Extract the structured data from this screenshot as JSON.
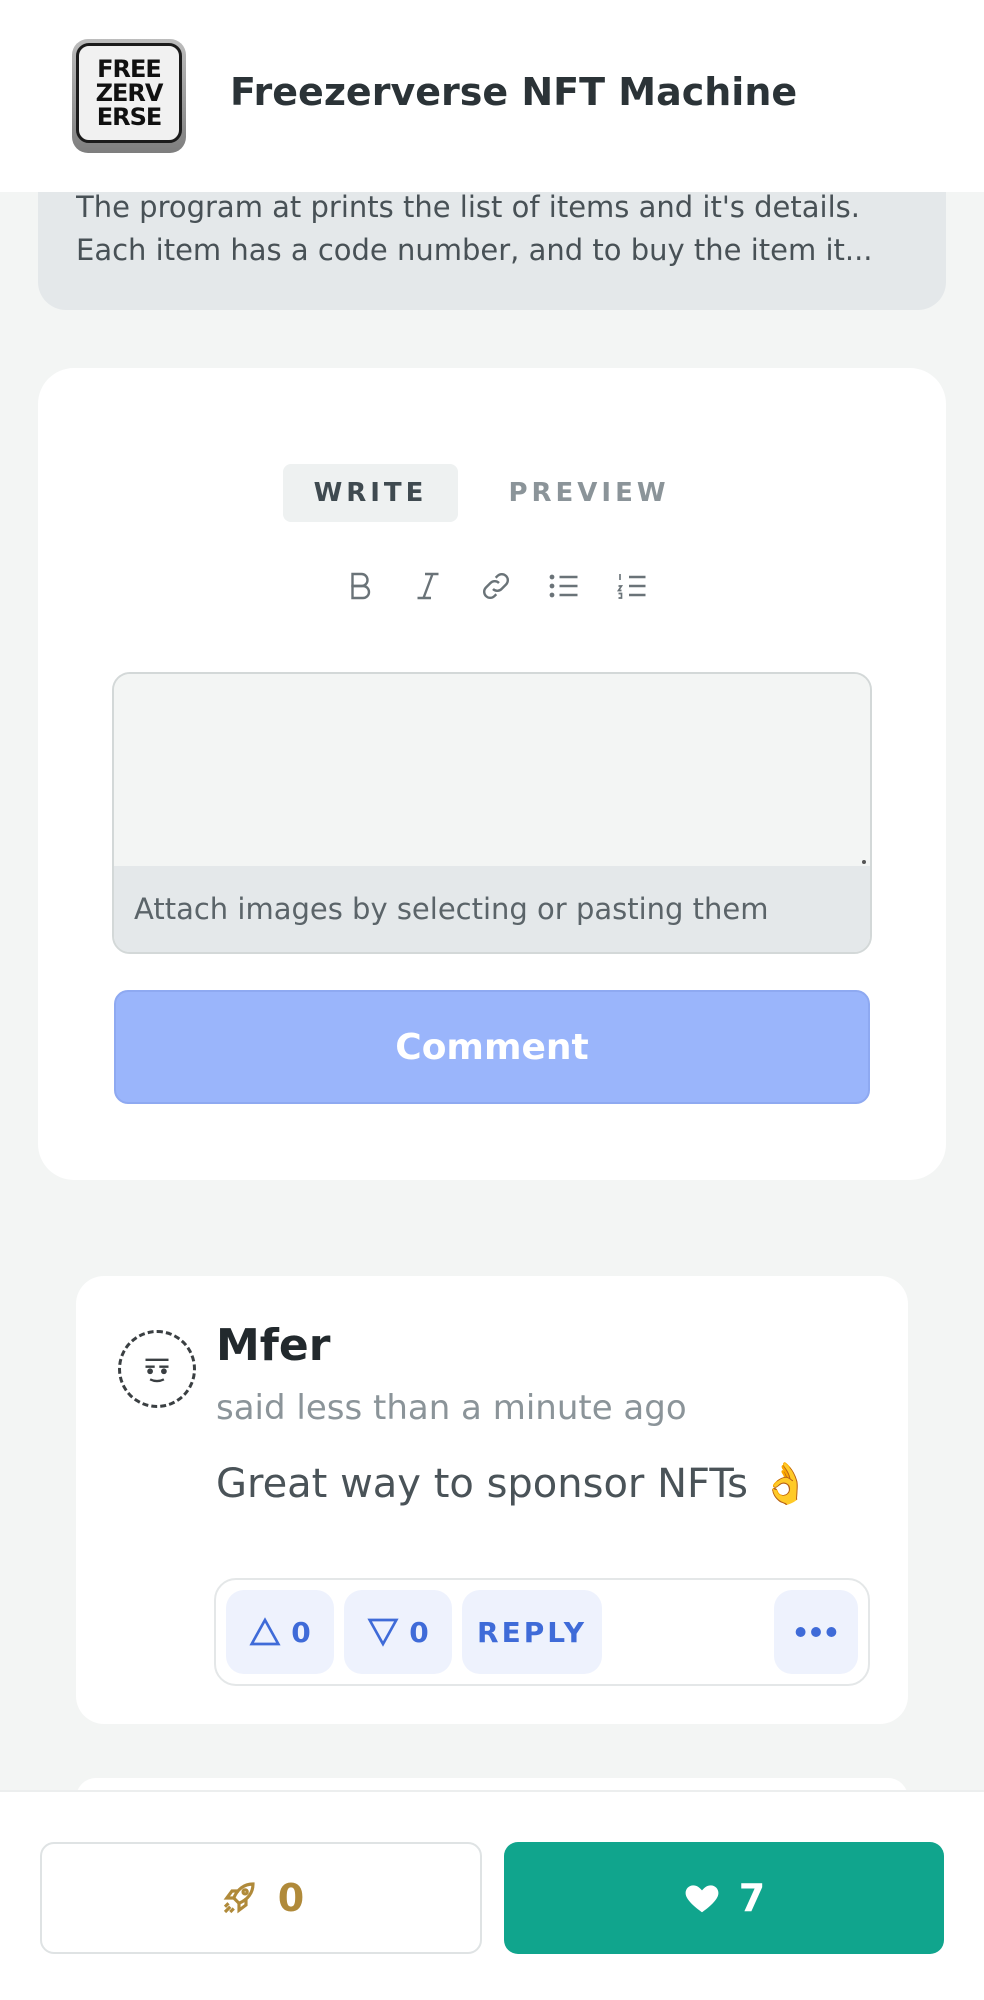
{
  "header": {
    "logo_lines": [
      "FREE",
      "ZERV",
      "ERSE"
    ],
    "title": "Freezerverse NFT Machine"
  },
  "description": {
    "line1": "The program at prints the list of items and it's details.",
    "line2": "Each item has a code number, and to buy the item it..."
  },
  "editor": {
    "tab_write": "WRITE",
    "tab_preview": "PREVIEW",
    "toolbar": [
      "bold-icon",
      "italic-icon",
      "link-icon",
      "bulleted-list-icon",
      "numbered-list-icon"
    ],
    "textarea_value": "",
    "attach_hint": "Attach images by selecting or pasting them",
    "submit_label": "Comment"
  },
  "comment": {
    "author": "Mfer",
    "timestamp": "said less than a minute ago",
    "text": "Great way to sponsor NFTs 👌",
    "upvotes": "0",
    "downvotes": "0",
    "reply_label": "REPLY"
  },
  "bottom_bar": {
    "boost_count": "0",
    "like_count": "7"
  },
  "colors": {
    "accent_green": "#10a58d",
    "comment_button": "#9ab5fb",
    "action_blue": "#3f6bd8",
    "boost_gold": "#b08a3a"
  }
}
